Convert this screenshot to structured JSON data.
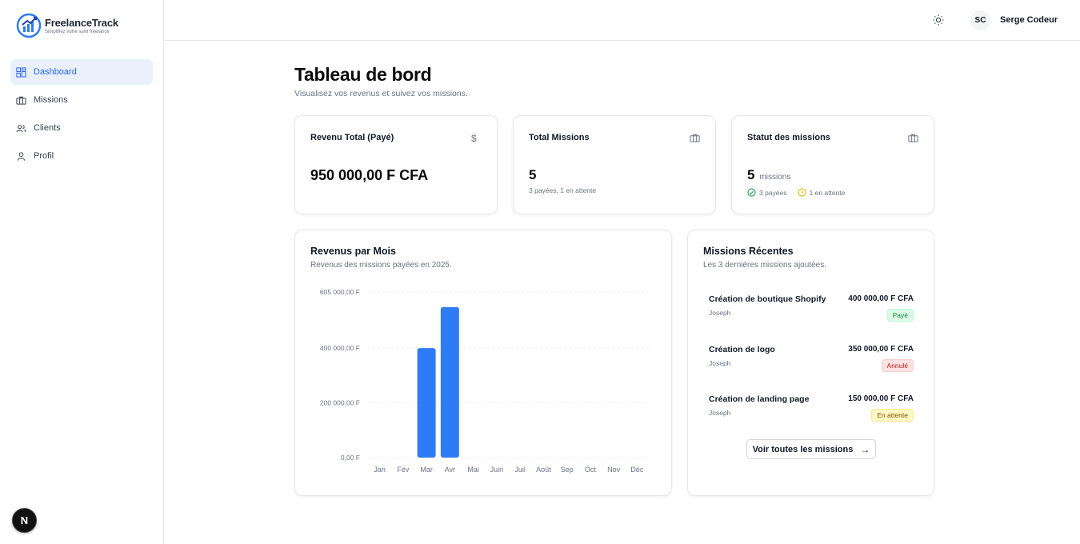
{
  "brand": {
    "title": "FreelanceTrack",
    "tagline": "Simplifiez votre suivi freelance"
  },
  "sidebar": {
    "items": [
      {
        "label": "Dashboard",
        "icon": "dashboard-icon",
        "active": true
      },
      {
        "label": "Missions",
        "icon": "briefcase-icon",
        "active": false
      },
      {
        "label": "Clients",
        "icon": "users-icon",
        "active": false
      },
      {
        "label": "Profil",
        "icon": "user-icon",
        "active": false
      }
    ],
    "next_badge": "N"
  },
  "header": {
    "avatar_initials": "SC",
    "user_name": "Serge Codeur",
    "theme_icon": "sun-icon"
  },
  "main": {
    "title": "Tableau de bord",
    "subtitle": "Visualisez vos revenus et suivez vos missions."
  },
  "stats": {
    "revenue": {
      "title": "Revenu Total (Payé)",
      "value": "950 000,00 F CFA",
      "icon": "dollar-icon"
    },
    "missions": {
      "title": "Total Missions",
      "value": "5",
      "sub": "3 payées, 1 en attente",
      "icon": "briefcase-icon"
    },
    "status": {
      "title": "Statut des missions",
      "value": "5",
      "unit": "missions",
      "paid": "3 payées",
      "pending": "1 en attente",
      "icon": "briefcase-icon"
    }
  },
  "revenue_chart": {
    "title": "Revenus par Mois",
    "subtitle": "Revenus des missions payées en 2025."
  },
  "chart_data": {
    "type": "bar",
    "title": "Revenus par Mois",
    "categories": [
      "Jan",
      "Fév",
      "Mar",
      "Avr",
      "Mai",
      "Juin",
      "Juil",
      "Août",
      "Sep",
      "Oct",
      "Nov",
      "Déc"
    ],
    "values": [
      0,
      0,
      400000,
      550000,
      0,
      0,
      0,
      0,
      0,
      0,
      0,
      0
    ],
    "yticks": [
      0,
      200000,
      400000,
      605000
    ],
    "ytick_labels": [
      "0,00 F",
      "200 000,00 F",
      "400 000,00 F",
      "605 000,00 F"
    ],
    "ylim": [
      0,
      605000
    ],
    "grid": true,
    "color": "#2f7bf5"
  },
  "recent": {
    "title": "Missions Récentes",
    "subtitle": "Les 3 dernières missions ajoutées.",
    "items": [
      {
        "name": "Création de boutique Shopify",
        "client": "Joseph",
        "amount": "400 000,00 F CFA",
        "status": "Payé"
      },
      {
        "name": "Création de logo",
        "client": "Joseph",
        "amount": "350 000,00 F CFA",
        "status": "Annulé"
      },
      {
        "name": "Création de landing page",
        "client": "Joseph",
        "amount": "150 000,00 F CFA",
        "status": "En attente"
      }
    ],
    "view_all": "Voir toutes les missions"
  },
  "colors": {
    "accent": "#2563eb",
    "bar": "#2f7bf5",
    "paid": "#16a34a",
    "pending": "#eab308"
  }
}
